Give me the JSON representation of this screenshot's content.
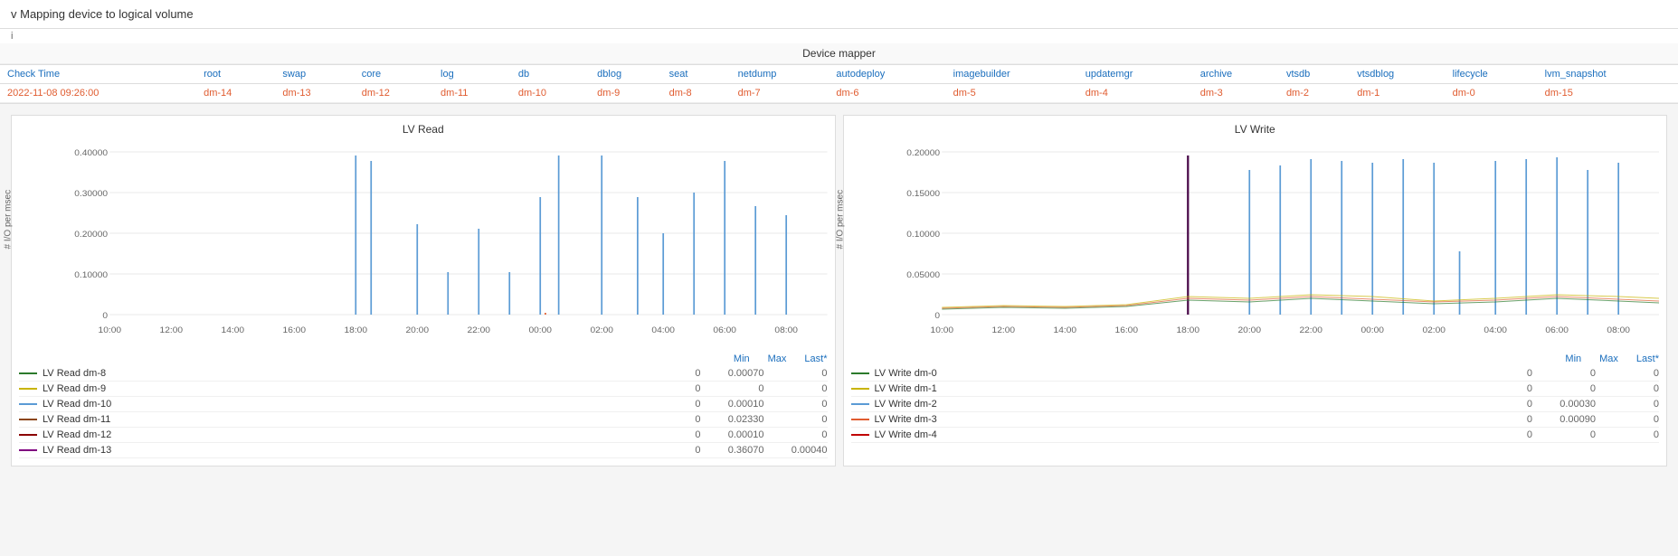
{
  "header": {
    "title": "Mapping device to logical volume",
    "collapse_icon": "v",
    "info": "i"
  },
  "device_mapper": {
    "label": "Device mapper",
    "columns": [
      {
        "key": "check_time",
        "label": "Check Time"
      },
      {
        "key": "root",
        "label": "root"
      },
      {
        "key": "swap",
        "label": "swap"
      },
      {
        "key": "core",
        "label": "core"
      },
      {
        "key": "log",
        "label": "log"
      },
      {
        "key": "db",
        "label": "db"
      },
      {
        "key": "dblog",
        "label": "dblog"
      },
      {
        "key": "seat",
        "label": "seat"
      },
      {
        "key": "netdump",
        "label": "netdump"
      },
      {
        "key": "autodeploy",
        "label": "autodeploy"
      },
      {
        "key": "imagebuilder",
        "label": "imagebuilder"
      },
      {
        "key": "updatemgr",
        "label": "updatemgr"
      },
      {
        "key": "archive",
        "label": "archive"
      },
      {
        "key": "vtsdb",
        "label": "vtsdb"
      },
      {
        "key": "vtsdblog",
        "label": "vtsdblog"
      },
      {
        "key": "lifecycle",
        "label": "lifecycle"
      },
      {
        "key": "lvm_snapshot",
        "label": "lvm_snapshot"
      }
    ],
    "rows": [
      {
        "check_time": "2022-11-08 09:26:00",
        "root": "dm-14",
        "swap": "dm-13",
        "core": "dm-12",
        "log": "dm-11",
        "db": "dm-10",
        "dblog": "dm-9",
        "seat": "dm-8",
        "netdump": "dm-7",
        "autodeploy": "dm-6",
        "imagebuilder": "dm-5",
        "updatemgr": "dm-4",
        "archive": "dm-3",
        "vtsdb": "dm-2",
        "vtsdblog": "dm-1",
        "lifecycle": "dm-0",
        "lvm_snapshot": "dm-15"
      }
    ]
  },
  "lv_read_chart": {
    "title": "LV Read",
    "y_label": "# I/O per msec",
    "y_ticks": [
      "0.40000",
      "0.30000",
      "0.20000",
      "0.10000",
      "0"
    ],
    "x_ticks": [
      "10:00",
      "12:00",
      "14:00",
      "16:00",
      "18:00",
      "20:00",
      "22:00",
      "00:00",
      "02:00",
      "04:00",
      "06:00",
      "08:00"
    ],
    "legend_header": [
      "Min",
      "Max",
      "Last*"
    ],
    "legend": [
      {
        "label": "LV Read dm-8",
        "color": "#2c7a2c",
        "min": "0",
        "max": "0.00070",
        "last": "0"
      },
      {
        "label": "LV Read dm-9",
        "color": "#c8b400",
        "min": "0",
        "max": "0",
        "last": "0"
      },
      {
        "label": "LV Read dm-10",
        "color": "#5b9bd5",
        "min": "0",
        "max": "0.00010",
        "last": "0"
      },
      {
        "label": "LV Read dm-11",
        "color": "#8b4513",
        "min": "0",
        "max": "0.02330",
        "last": "0"
      },
      {
        "label": "LV Read dm-12",
        "color": "#8b0000",
        "min": "0",
        "max": "0.00010",
        "last": "0"
      },
      {
        "label": "LV Read dm-13",
        "color": "#800080",
        "min": "0",
        "max": "0.36070",
        "last": "0.00040"
      }
    ]
  },
  "lv_write_chart": {
    "title": "LV Write",
    "y_label": "# I/O per msec",
    "y_ticks": [
      "0.20000",
      "0.15000",
      "0.10000",
      "0.05000",
      "0"
    ],
    "x_ticks": [
      "10:00",
      "12:00",
      "14:00",
      "16:00",
      "18:00",
      "20:00",
      "22:00",
      "00:00",
      "02:00",
      "04:00",
      "06:00",
      "08:00"
    ],
    "legend_header": [
      "Min",
      "Max",
      "Last*"
    ],
    "legend": [
      {
        "label": "LV Write dm-0",
        "color": "#2c7a2c",
        "min": "0",
        "max": "0",
        "last": "0"
      },
      {
        "label": "LV Write dm-1",
        "color": "#c8b400",
        "min": "0",
        "max": "0",
        "last": "0"
      },
      {
        "label": "LV Write dm-2",
        "color": "#5b9bd5",
        "min": "0",
        "max": "0.00030",
        "last": "0"
      },
      {
        "label": "LV Write dm-3",
        "color": "#e05c30",
        "min": "0",
        "max": "0.00090",
        "last": "0"
      },
      {
        "label": "LV Write dm-4",
        "color": "#c00000",
        "min": "0",
        "max": "0",
        "last": "0"
      }
    ]
  }
}
